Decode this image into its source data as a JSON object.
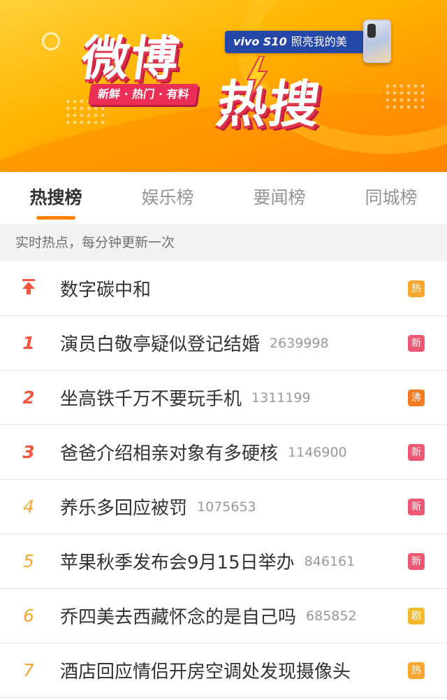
{
  "banner": {
    "logo_line1": "微博",
    "logo_line2": "热搜",
    "slogan": "新鲜 · 热门 · 有料",
    "ad_brand": "vivo S10",
    "ad_tagline": "照亮我的美"
  },
  "tabs": [
    {
      "label": "热搜榜",
      "active": true
    },
    {
      "label": "娱乐榜",
      "active": false
    },
    {
      "label": "要闻榜",
      "active": false
    },
    {
      "label": "同城榜",
      "active": false
    }
  ],
  "subheading": "实时热点，每分钟更新一次",
  "items": [
    {
      "rank": "",
      "pinned": true,
      "title": "数字碳中和",
      "count": "",
      "badge": "热",
      "badge_color": "#f8a72f"
    },
    {
      "rank": "1",
      "pinned": false,
      "title": "演员白敬亭疑似登记结婚",
      "count": "2639998",
      "badge": "新",
      "badge_color": "#ec5873"
    },
    {
      "rank": "2",
      "pinned": false,
      "title": "坐高铁千万不要玩手机",
      "count": "1311199",
      "badge": "沸",
      "badge_color": "#f47b22"
    },
    {
      "rank": "3",
      "pinned": false,
      "title": "爸爸介绍相亲对象有多硬核",
      "count": "1146900",
      "badge": "新",
      "badge_color": "#ec5873"
    },
    {
      "rank": "4",
      "pinned": false,
      "title": "养乐多回应被罚",
      "count": "1075653",
      "badge": "新",
      "badge_color": "#ec5873"
    },
    {
      "rank": "5",
      "pinned": false,
      "title": "苹果秋季发布会9月15日举办",
      "count": "846161",
      "badge": "新",
      "badge_color": "#ec5873"
    },
    {
      "rank": "6",
      "pinned": false,
      "title": "乔四美去西藏怀念的是自己吗",
      "count": "685852",
      "badge": "剧",
      "badge_color": "#f5b92e"
    },
    {
      "rank": "7",
      "pinned": false,
      "title": "酒店回应情侣开房空调处发现摄像头",
      "count": "",
      "badge": "热",
      "badge_color": "#f8a72f"
    }
  ],
  "colors": {
    "accent": "#ff8200",
    "rank_top": "#f4573e",
    "rank_other": "#f6a735"
  },
  "icons": {
    "pinned": "pin-top-icon"
  }
}
